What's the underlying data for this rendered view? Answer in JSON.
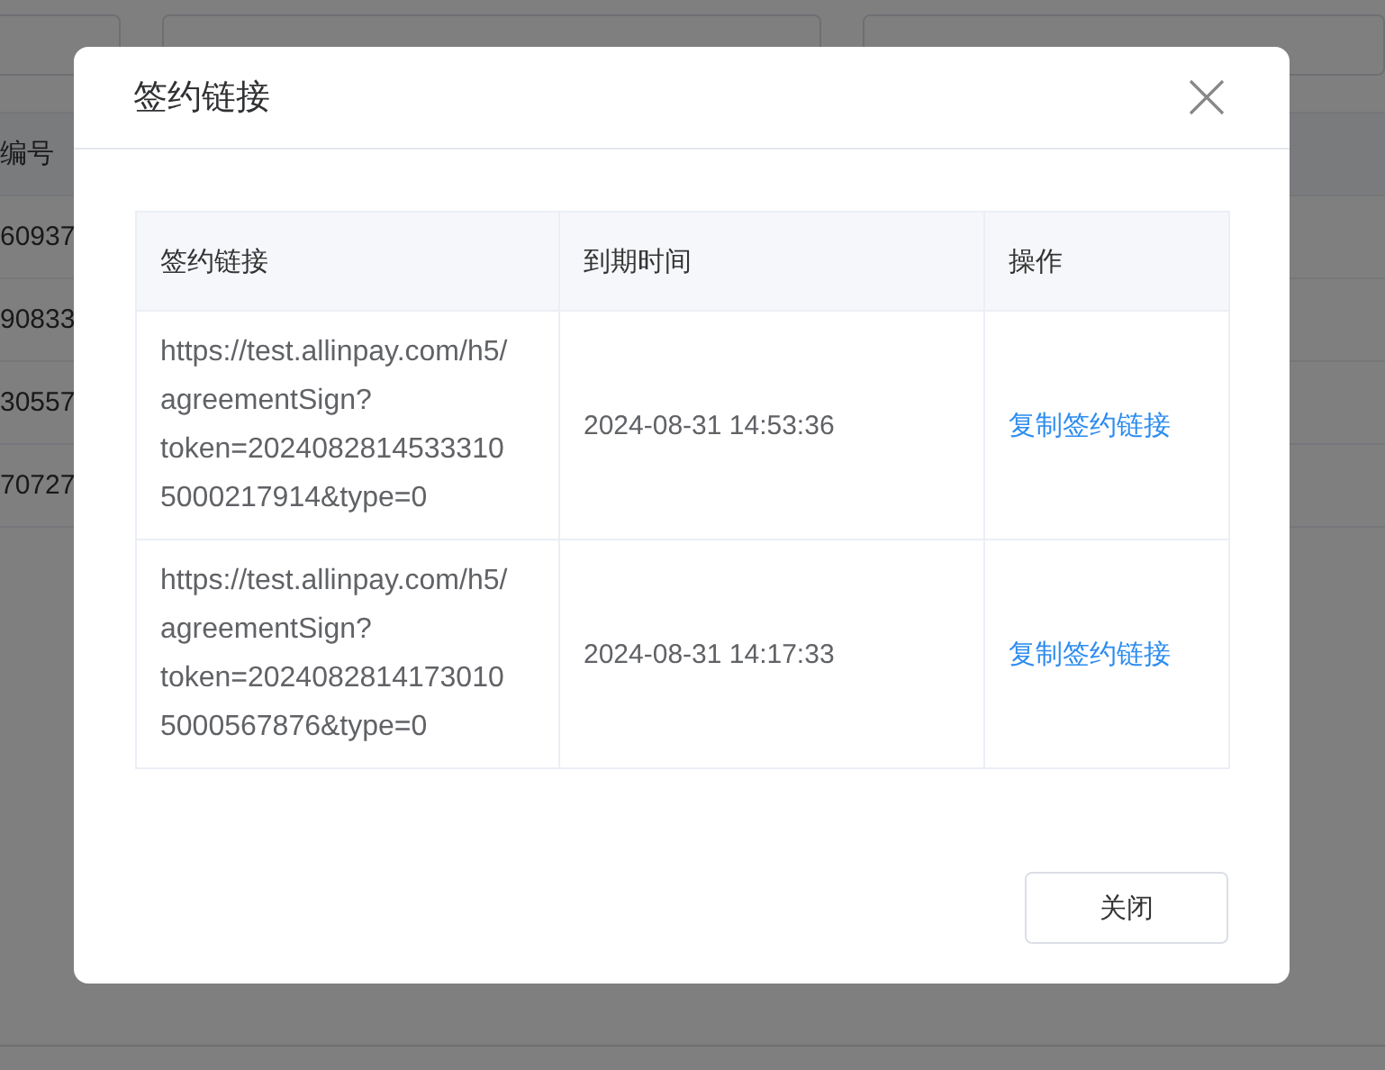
{
  "background": {
    "table": {
      "column_header": "编号",
      "rows": [
        "60937",
        "90833",
        "30557",
        "70727"
      ]
    }
  },
  "dialog": {
    "title": "签约链接",
    "table": {
      "columns": [
        "签约链接",
        "到期时间",
        "操作"
      ],
      "rows": [
        {
          "link": "https://test.allinpay.com/h5/agreementSign?token=20240828145333105000217914&type=0",
          "expires": "2024-08-31 14:53:36",
          "action": "复制签约链接"
        },
        {
          "link": "https://test.allinpay.com/h5/agreementSign?token=20240828141730105000567876&type=0",
          "expires": "2024-08-31 14:17:33",
          "action": "复制签约链接"
        }
      ]
    },
    "buttons": [
      "关闭"
    ]
  }
}
